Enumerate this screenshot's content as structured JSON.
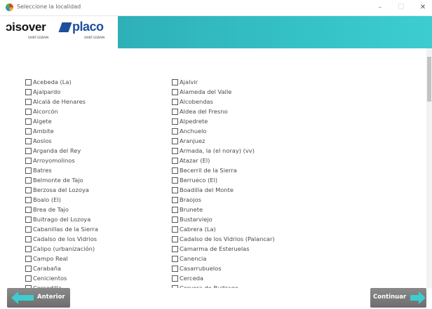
{
  "window": {
    "title": "Seleccione la localidad",
    "controls": {
      "minimize": "–",
      "maximize": "☐",
      "close": "✕"
    }
  },
  "header": {
    "logo_isover": "ɔisover",
    "logo_isover_sub": "SAINT-GOBAIN",
    "logo_placo": "placo",
    "logo_placo_sub": "SAINT-GOBAIN",
    "accent_color": "#35c2c7"
  },
  "localities": {
    "left": [
      "Acebeda (La)",
      "Ajalpardo",
      "Alcalá de Henares",
      "Alcorcón",
      "Algete",
      "Ambite",
      "Aoslos",
      "Arganda del Rey",
      "Arroyomolinos",
      "Batres",
      "Belmonte de Tajo",
      "Berzosa del Lozoya",
      "Boalo (El)",
      "Brea de Tajo",
      "Buitrago del Lozoya",
      "Cabanillas de la Sierra",
      "Cadalso de los Vidrios",
      "Calipo (urbanización)",
      "Campo Real",
      "Carabaña",
      "Cenicientos",
      "Cercedilla"
    ],
    "right": [
      "Ajalvir",
      "Alameda del Valle",
      "Alcobendas",
      "Aldea del Fresno",
      "Alpedrete",
      "Anchuelo",
      "Aranjuez",
      "Armada, la (el noray) (vv)",
      "Atazar (El)",
      "Becerril de la Sierra",
      "Berrueco (El)",
      "Boadilla del Monte",
      "Braojos",
      "Brunete",
      "Bustarviejo",
      "Cabrera (La)",
      "Cadalso de los Vidrios (Palancar)",
      "Camarma de Esteruelas",
      "Canencia",
      "Casarrubuelos",
      "Cerceda",
      "Cervera de Buitrago"
    ]
  },
  "footer": {
    "back_label": "Anterior",
    "next_label": "Continuar",
    "arrow_color": "#3dcdd0"
  }
}
